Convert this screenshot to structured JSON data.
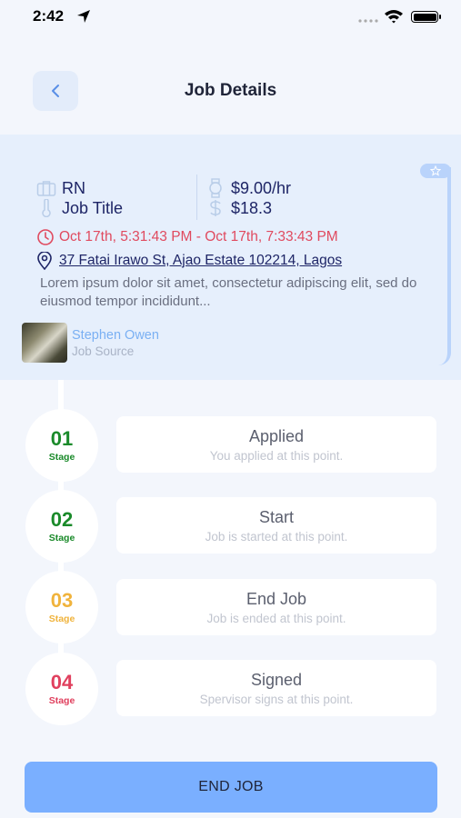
{
  "status_bar": {
    "time": "2:42"
  },
  "header": {
    "title": "Job Details"
  },
  "job": {
    "role": "RN",
    "title": "Job Title",
    "rate": "$9.00/hr",
    "amount": "$18.3",
    "time_range": "Oct 17th, 5:31:43 PM - Oct 17th, 7:33:43 PM",
    "address": "37 Fatai Irawo St, Ajao Estate 102214, Lagos",
    "description": "Lorem ipsum dolor sit amet, consectetur adipiscing elit, sed do eiusmod tempor incididunt...",
    "source_name": "Stephen Owen",
    "source_label": "Job Source"
  },
  "stages": [
    {
      "number": "01",
      "label": "Stage",
      "title": "Applied",
      "subtitle": "You applied at this point.",
      "color": "#1a8a2a"
    },
    {
      "number": "02",
      "label": "Stage",
      "title": "Start",
      "subtitle": "Job is started at this point.",
      "color": "#1a8a2a"
    },
    {
      "number": "03",
      "label": "Stage",
      "title": "End Job",
      "subtitle": "Job is ended at this point.",
      "color": "#f0b33c"
    },
    {
      "number": "04",
      "label": "Stage",
      "title": "Signed",
      "subtitle": "Spervisor signs at this point.",
      "color": "#e0405e"
    }
  ],
  "footer": {
    "end_button": "END JOB"
  },
  "colors": {
    "accent": "#7aafff",
    "danger": "#e04a5f",
    "link": "#1e2566"
  },
  "icons": [
    "location-arrow-icon",
    "signal-icon",
    "wifi-icon",
    "battery-icon",
    "chevron-left-icon",
    "star-icon",
    "briefcase-icon",
    "watch-icon",
    "thermometer-icon",
    "dollar-icon",
    "clock-icon",
    "map-pin-icon"
  ]
}
